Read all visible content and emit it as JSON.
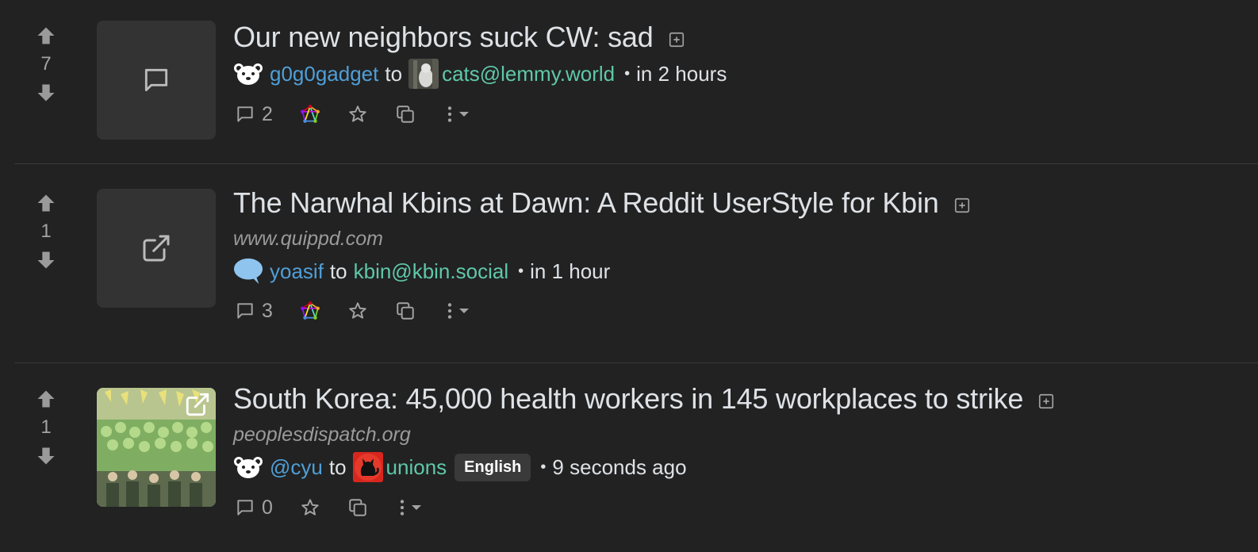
{
  "posts": [
    {
      "score": "7",
      "title": "Our new neighbors suck CW: sad",
      "domain": "",
      "author": "g0g0gadget",
      "to_label": "to",
      "community": "cats@lemmy.world",
      "language": "",
      "time": "in 2 hours",
      "comments": "2",
      "thumbnail": "comment-icon"
    },
    {
      "score": "1",
      "title": "The Narwhal Kbins at Dawn: A Reddit UserStyle for Kbin",
      "domain": "www.quippd.com",
      "author": "yoasif",
      "to_label": "to",
      "community": "kbin@kbin.social",
      "language": "",
      "time": "in 1 hour",
      "comments": "3",
      "thumbnail": "external-link-icon"
    },
    {
      "score": "1",
      "title": "South Korea: 45,000 health workers in 145 workplaces to strike",
      "domain": "peoplesdispatch.org",
      "author": "@cyu",
      "to_label": "to",
      "community": "unions",
      "language": "English",
      "time": "9 seconds ago",
      "comments": "0",
      "thumbnail": "image"
    }
  ],
  "meta_separator": "•",
  "colors": {
    "background": "#222222",
    "user_link": "#4f9fd8",
    "community_link": "#5fc8a8",
    "muted": "#a3a3a3"
  }
}
